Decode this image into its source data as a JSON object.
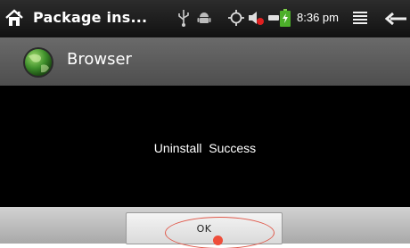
{
  "status_bar": {
    "title": "Package ins...",
    "time": "8:36 pm",
    "icons": [
      "home-icon",
      "usb-icon",
      "android-debug-icon",
      "gps-icon",
      "volume-muted-icon",
      "battery-charging-icon",
      "menu-icon",
      "back-icon"
    ]
  },
  "dialog": {
    "title": "Browser",
    "icon": "globe-icon",
    "message": "Uninstall  Success",
    "ok_label": "OK"
  },
  "colors": {
    "annotation": "#e05a4c",
    "status_bar_bg": "#1a1a1a",
    "title_bar_bg": "#5a5a5a",
    "button_bar_bg": "#bdbdbd"
  }
}
